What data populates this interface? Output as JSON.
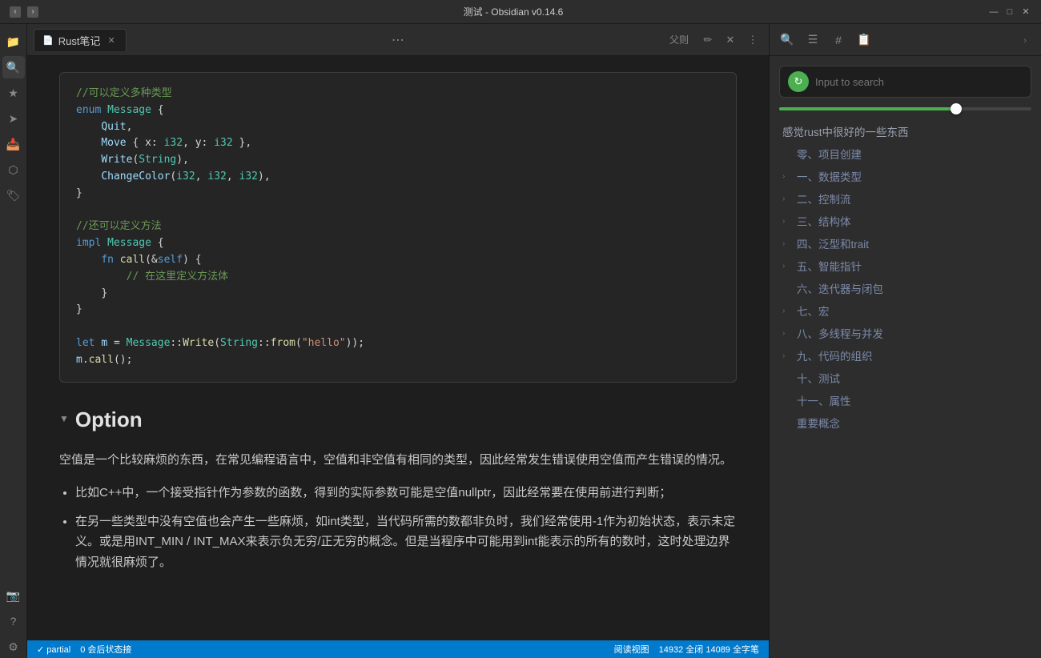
{
  "titleBar": {
    "title": "测试 - Obsidian v0.14.6",
    "backBtn": "‹",
    "forwardBtn": "›",
    "minimizeBtn": "—",
    "maximizeBtn": "□",
    "closeBtn": "✕"
  },
  "tab": {
    "docIcon": "📄",
    "title": "Rust笔记",
    "editIcon": "✏",
    "closeIcon": "✕",
    "moreIcon": "⋯",
    "toolbarLabel": "父则"
  },
  "code": {
    "comment1": "//可以定义多种类型",
    "enum_decl": "enum",
    "enum_name": "Message",
    "quit": "Quit,",
    "move_line": "Move { x: ",
    "i32_1": "i32",
    "comma1": ", y: ",
    "i32_2": "i32",
    "close_brace": " },",
    "write": "Write(",
    "string_type": "String",
    "write_close": "),",
    "change": "ChangeColor(",
    "nums": "i32, i32, i32",
    "change_close": "),",
    "comment2": "//还可以定义方法",
    "impl_kw": "impl",
    "impl_name": "Message",
    "fn_kw": "fn",
    "fn_name": "call",
    "fn_params": "(&self)",
    "fn_comment": "// 在这里定义方法体",
    "let_line": "let m = Message::Write(String::from(\"hello\"));",
    "call_line": "m.call();"
  },
  "section": {
    "arrow": "▼",
    "title": "Option",
    "para1": "空值是一个比较麻烦的东西，在常见编程语言中，空值和非空值有相同的类型，因此经常发生错误使用空值而产生错误的情况。",
    "bullet1": "比如C++中，一个接受指针作为参数的函数，得到的实际参数可能是空值nullptr，因此经常要在使用前进行判断；",
    "bullet2": "在另一些类型中没有空值也会产生一些麻烦，如int类型，当代码所需的数都非负时，我们经常使用-1作为初始状态，表示未定义。或是用INT_MIN / INT_MAX来表示负无穷/正无穷的概念。但是当程序中可能用到int能表示的所有的数时，这时处理边界情况就很麻烦了。"
  },
  "rightPanel": {
    "icons": {
      "search": "🔍",
      "list": "☰",
      "hash": "#",
      "doc": "📋"
    },
    "searchPlaceholder": "Input to search",
    "toc": {
      "top": "感觉rust中很好的一些东西",
      "items": [
        {
          "label": "零、项目创建",
          "hasArrow": false
        },
        {
          "label": "一、数据类型",
          "hasArrow": true
        },
        {
          "label": "二、控制流",
          "hasArrow": true
        },
        {
          "label": "三、结构体",
          "hasArrow": true
        },
        {
          "label": "四、泛型和trait",
          "hasArrow": true
        },
        {
          "label": "五、智能指针",
          "hasArrow": true
        },
        {
          "label": "六、迭代器与闭包",
          "hasArrow": false
        },
        {
          "label": "七、宏",
          "hasArrow": true
        },
        {
          "label": "八、多线程与并发",
          "hasArrow": true
        },
        {
          "label": "九、代码的组织",
          "hasArrow": true
        },
        {
          "label": "十、测试",
          "hasArrow": false
        },
        {
          "label": "十一、属性",
          "hasArrow": false
        },
        {
          "label": "重要概念",
          "hasArrow": false
        }
      ]
    }
  },
  "statusBar": {
    "items": [
      "✓ partial",
      "0 会后状态接",
      "阅读视图",
      "14932 全闭  14089 全字笔"
    ]
  }
}
